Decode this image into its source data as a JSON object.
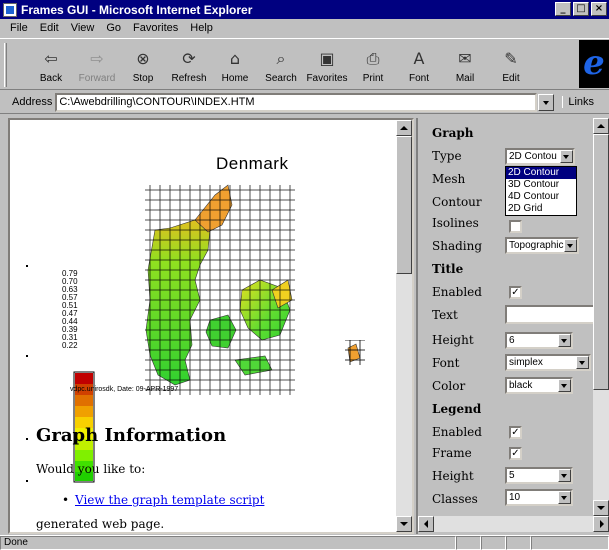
{
  "window": {
    "title": "Frames GUI - Microsoft Internet Explorer"
  },
  "menu": [
    "File",
    "Edit",
    "View",
    "Go",
    "Favorites",
    "Help"
  ],
  "toolbar": {
    "buttons": [
      {
        "label": "Back",
        "icon": "back-arrow-icon"
      },
      {
        "label": "Forward",
        "icon": "forward-arrow-icon"
      },
      {
        "label": "Stop",
        "icon": "stop-icon"
      },
      {
        "label": "Refresh",
        "icon": "refresh-icon"
      },
      {
        "label": "Home",
        "icon": "home-icon"
      },
      {
        "label": "Search",
        "icon": "search-icon"
      },
      {
        "label": "Favorites",
        "icon": "favorites-icon"
      },
      {
        "label": "Print",
        "icon": "print-icon"
      },
      {
        "label": "Font",
        "icon": "font-icon"
      },
      {
        "label": "Mail",
        "icon": "mail-icon"
      },
      {
        "label": "Edit",
        "icon": "edit-icon"
      }
    ]
  },
  "address": {
    "label": "Address",
    "value": "C:\\Awebdrilling\\CONTOUR\\INDEX.HTM",
    "links_label": "Links"
  },
  "left": {
    "map_title": "Denmark",
    "plot_caption": "vdpc.unirosdk, Date: 09-APR-1997",
    "legend_values": [
      "0.79",
      "0.70",
      "0.63",
      "0.57",
      "0.51",
      "0.47",
      "0.44",
      "0.39",
      "0.31",
      "0.22"
    ],
    "section_title": "Graph Information",
    "paragraph": "Would you like to:",
    "bullet": "•",
    "link_text": "View the graph template script",
    "cut_text": "generated web page."
  },
  "right": {
    "graph_heading": "Graph",
    "type_label": "Type",
    "type_value": "2D Contou",
    "type_options": [
      "2D Contour",
      "3D Contour",
      "4D Contour",
      "2D Grid"
    ],
    "mesh_label": "Mesh",
    "contour_label": "Contour",
    "isolines_label": "Isolines",
    "shading_label": "Shading",
    "shading_value": "Topographic",
    "title_heading": "Title",
    "title_enabled_label": "Enabled",
    "title_text_label": "Text",
    "title_height_label": "Height",
    "title_height_value": "6",
    "title_font_label": "Font",
    "title_font_value": "simplex",
    "title_color_label": "Color",
    "title_color_value": "black",
    "legend_heading": "Legend",
    "legend_enabled_label": "Enabled",
    "legend_frame_label": "Frame",
    "legend_height_label": "Height",
    "legend_height_value": "5",
    "legend_classes_label": "Classes",
    "legend_classes_value": "10",
    "check_mark": "✓"
  },
  "status": {
    "text": "Done"
  }
}
